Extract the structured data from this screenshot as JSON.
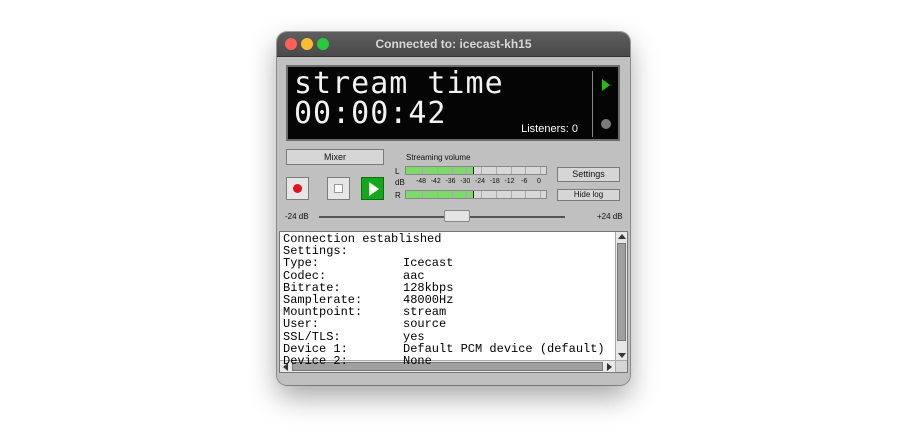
{
  "window": {
    "title": "Connected to: icecast-kh15"
  },
  "display": {
    "line1": "stream time",
    "line2": "00:00:42",
    "listeners": "Listeners: 0"
  },
  "controls": {
    "mixer_label": "Mixer",
    "settings_label": "Settings",
    "hide_log_label": "Hide log",
    "record_icon": "record-icon",
    "stop_icon": "stop-icon",
    "play_icon": "play-icon"
  },
  "meter": {
    "title": "Streaming volume",
    "left_label": "L",
    "db_label": "dB",
    "right_label": "R",
    "scale": [
      "-48",
      "-42",
      "-36",
      "-30",
      "-24",
      "-18",
      "-12",
      "-6",
      "0"
    ],
    "left_level_fraction": 0.47,
    "right_level_fraction": 0.47,
    "fill_color": "#7ed86a"
  },
  "slider": {
    "min_label": "-24 dB",
    "max_label": "+24 dB",
    "value_fraction": 0.56
  },
  "log": {
    "lines": [
      {
        "key": "Connection established",
        "value": ""
      },
      {
        "key": "Settings:",
        "value": ""
      },
      {
        "key": "Type:",
        "value": "Icecast"
      },
      {
        "key": "Codec:",
        "value": "aac"
      },
      {
        "key": "Bitrate:",
        "value": "128kbps"
      },
      {
        "key": "Samplerate:",
        "value": "48000Hz"
      },
      {
        "key": "Mountpoint:",
        "value": "stream"
      },
      {
        "key": "User:",
        "value": "source"
      },
      {
        "key": "SSL/TLS:",
        "value": "yes"
      },
      {
        "key": "Device 1:",
        "value": "Default PCM device (default)"
      },
      {
        "key": "Device 2:",
        "value": "None"
      }
    ]
  }
}
